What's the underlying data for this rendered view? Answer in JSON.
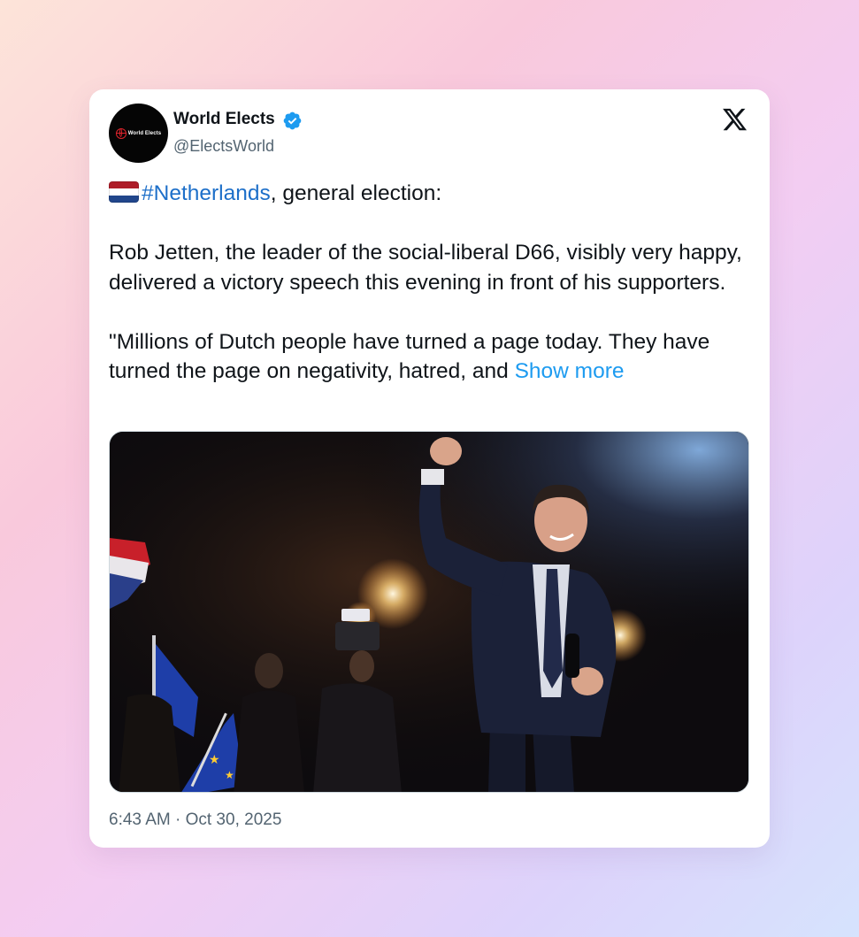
{
  "author": {
    "avatar_text": "World Elects",
    "name": "World Elects",
    "handle": "@ElectsWorld",
    "verified": true
  },
  "platform_icon": "x-logo-icon",
  "post": {
    "hashtag": "#Netherlands",
    "line1_suffix": ", general election:",
    "paragraph2": "Rob Jetten, the leader of the social-liberal D66, visibly very happy, delivered a victory speech this evening in front of his supporters.",
    "paragraph3": "\"Millions of Dutch people have turned a page today. They have turned the page on negativity, hatred, and ",
    "show_more": "Show more"
  },
  "media": {
    "icon": "photo-of-man-raising-fist-on-stage"
  },
  "timestamp": "6:43 AM · Oct 30, 2025",
  "colors": {
    "verified": "#1d9bf0",
    "link": "#1d6fc9",
    "show_more": "#1d9bf0",
    "flag": [
      "#ae1c28",
      "#ffffff",
      "#21468b"
    ]
  }
}
